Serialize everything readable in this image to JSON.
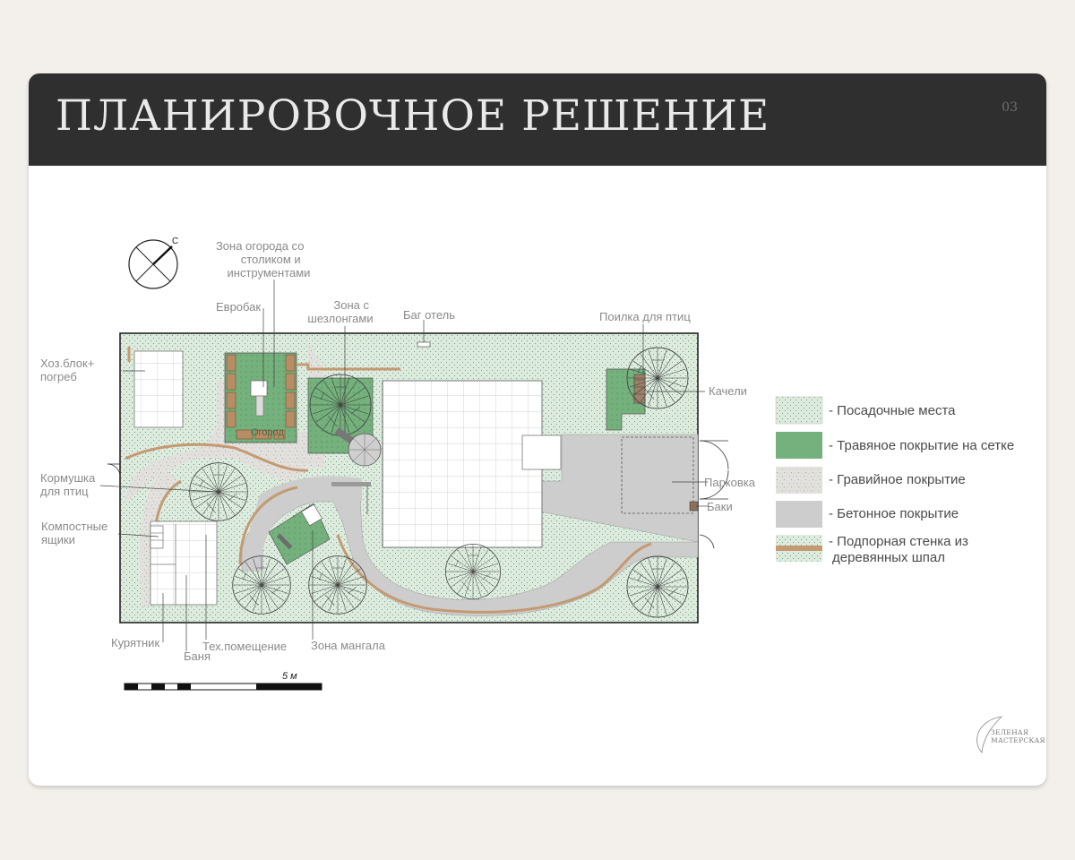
{
  "header": {
    "title": "ПЛАНИРОВОЧНОЕ РЕШЕНИЕ",
    "page_number": "03"
  },
  "compass": {
    "north_letter": "С"
  },
  "labels": {
    "garden_zone": [
      "Зона огорода со",
      "столиком и",
      "инструментами"
    ],
    "eurobak": "Евробак",
    "lounger_zone": [
      "Зона с",
      "шезлонгами"
    ],
    "bug_hotel": "Баг отель",
    "bird_drinker": "Поилка для птиц",
    "utility_block": [
      "Хоз.блок+",
      "погреб"
    ],
    "bird_feeder": [
      "Кормушка",
      "для птиц"
    ],
    "compost": [
      "Компостные",
      "ящики"
    ],
    "swings": "Качели",
    "parking": "Парковка",
    "bins": "Баки",
    "garden_bed": "Огород",
    "chicken_coop": "Курятник",
    "bathhouse": "Баня",
    "tech_room": "Тех.помещение",
    "bbq_zone": "Зона мангала"
  },
  "scale_bar": {
    "label": "5 м"
  },
  "legend": [
    {
      "swatch": "planting",
      "lines": [
        "- Посадочные места"
      ]
    },
    {
      "swatch": "grass-grid",
      "lines": [
        "- Травяное покрытие на сетке"
      ]
    },
    {
      "swatch": "gravel",
      "lines": [
        "- Гравийное покрытие"
      ]
    },
    {
      "swatch": "concrete",
      "lines": [
        "- Бетонное покрытие"
      ]
    },
    {
      "swatch": "sleeper-wall",
      "lines": [
        "- Подпорная стенка из",
        "деревянных шпал"
      ]
    }
  ],
  "logo": {
    "line1": "ЗЕЛЕНАЯ",
    "line2": "МАСТЕРСКАЯ"
  },
  "colors": {
    "header_bg": "#2f2f2f",
    "planting": "#dcebde",
    "grass_grid": "#74b17c",
    "gravel": "#e3e1de",
    "concrete": "#cdcdcd",
    "sleeper_wall": "#c49a72",
    "page_bg": "#f3efeb"
  }
}
